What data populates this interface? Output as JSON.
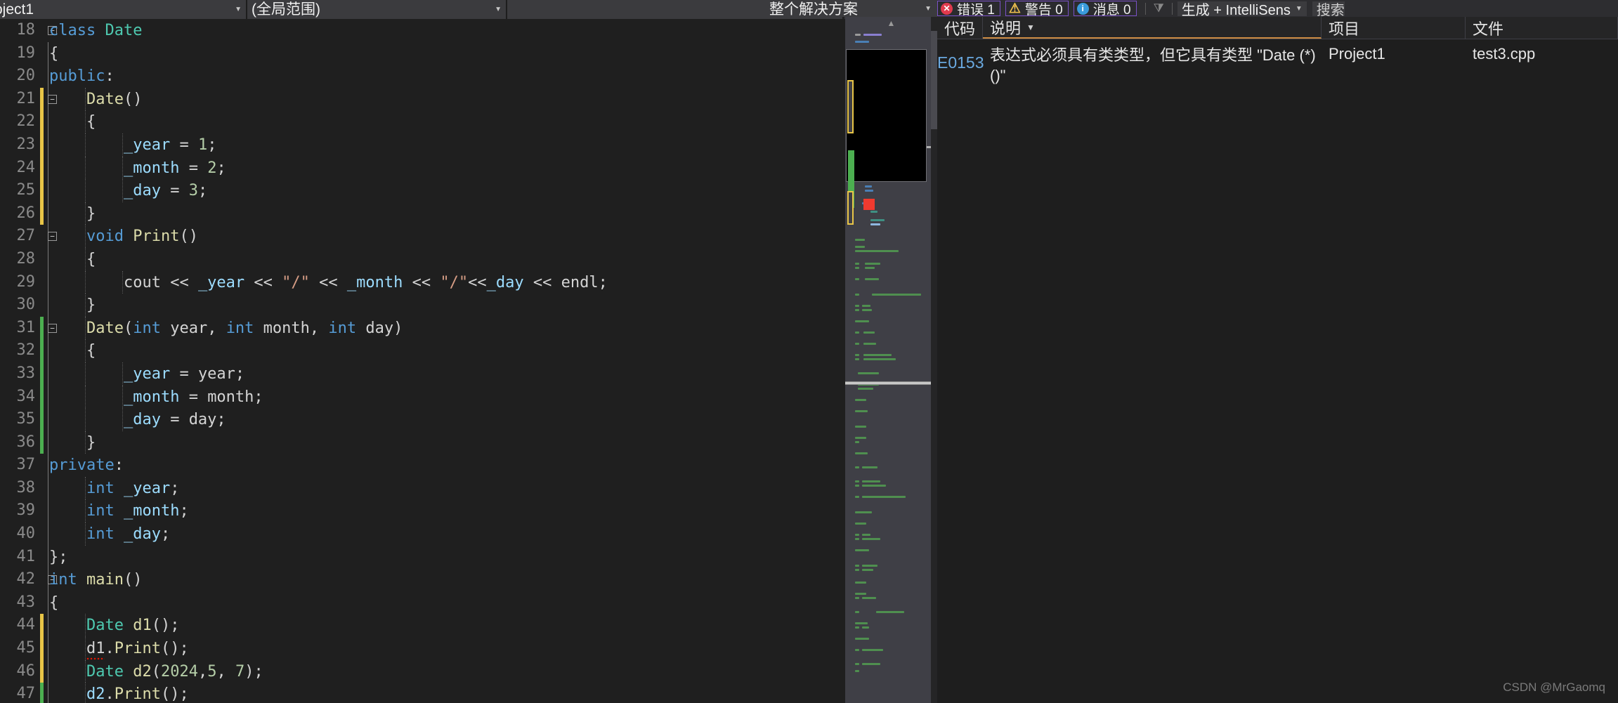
{
  "editor_navbar": {
    "project_combo": "oject1",
    "scope_combo": "(全局范围)",
    "member_combo": ""
  },
  "code": {
    "language": "cpp",
    "lines": [
      {
        "n": 18,
        "text": "class Date",
        "fold": "minus",
        "marker": "none",
        "tokens": [
          {
            "t": "class",
            "c": "kw"
          },
          {
            "t": " ",
            "c": "pl"
          },
          {
            "t": "Date",
            "c": "typ"
          }
        ],
        "indent": 0
      },
      {
        "n": 19,
        "text": "{",
        "fold": "none",
        "marker": "none",
        "tokens": [
          {
            "t": "{",
            "c": "pl"
          }
        ],
        "indent": 0
      },
      {
        "n": 20,
        "text": "public:",
        "fold": "none",
        "marker": "none",
        "tokens": [
          {
            "t": "public",
            "c": "kw"
          },
          {
            "t": ":",
            "c": "pl"
          }
        ],
        "indent": 0
      },
      {
        "n": 21,
        "text": "    Date()",
        "fold": "minus",
        "marker": "yellow",
        "tokens": [
          {
            "t": "    ",
            "c": "pl"
          },
          {
            "t": "Date",
            "c": "fn"
          },
          {
            "t": "()",
            "c": "pl"
          }
        ],
        "indent": 1
      },
      {
        "n": 22,
        "text": "    {",
        "fold": "none",
        "marker": "yellow",
        "tokens": [
          {
            "t": "    {",
            "c": "pl"
          }
        ],
        "indent": 1
      },
      {
        "n": 23,
        "text": "        _year = 1;",
        "fold": "none",
        "marker": "yellow",
        "tokens": [
          {
            "t": "        ",
            "c": "pl"
          },
          {
            "t": "_year",
            "c": "var"
          },
          {
            "t": " = ",
            "c": "pl"
          },
          {
            "t": "1",
            "c": "num"
          },
          {
            "t": ";",
            "c": "pl"
          }
        ],
        "indent": 2
      },
      {
        "n": 24,
        "text": "        _month = 2;",
        "fold": "none",
        "marker": "yellow",
        "tokens": [
          {
            "t": "        ",
            "c": "pl"
          },
          {
            "t": "_month",
            "c": "var"
          },
          {
            "t": " = ",
            "c": "pl"
          },
          {
            "t": "2",
            "c": "num"
          },
          {
            "t": ";",
            "c": "pl"
          }
        ],
        "indent": 2
      },
      {
        "n": 25,
        "text": "        _day = 3;",
        "fold": "none",
        "marker": "yellow",
        "tokens": [
          {
            "t": "        ",
            "c": "pl"
          },
          {
            "t": "_day",
            "c": "var"
          },
          {
            "t": " = ",
            "c": "pl"
          },
          {
            "t": "3",
            "c": "num"
          },
          {
            "t": ";",
            "c": "pl"
          }
        ],
        "indent": 2
      },
      {
        "n": 26,
        "text": "    }",
        "fold": "none",
        "marker": "yellow",
        "tokens": [
          {
            "t": "    }",
            "c": "pl"
          }
        ],
        "indent": 1
      },
      {
        "n": 27,
        "text": "    void Print()",
        "fold": "minus",
        "marker": "none",
        "tokens": [
          {
            "t": "    ",
            "c": "pl"
          },
          {
            "t": "void",
            "c": "kw"
          },
          {
            "t": " ",
            "c": "pl"
          },
          {
            "t": "Print",
            "c": "fn"
          },
          {
            "t": "()",
            "c": "pl"
          }
        ],
        "indent": 1
      },
      {
        "n": 28,
        "text": "    {",
        "fold": "none",
        "marker": "none",
        "tokens": [
          {
            "t": "    {",
            "c": "pl"
          }
        ],
        "indent": 1
      },
      {
        "n": 29,
        "text": "        cout << _year << \"/\" << _month << \"/\"<<_day << endl;",
        "fold": "none",
        "marker": "none",
        "tokens": [
          {
            "t": "        ",
            "c": "pl"
          },
          {
            "t": "cout",
            "c": "pl"
          },
          {
            "t": " << ",
            "c": "pl"
          },
          {
            "t": "_year",
            "c": "var"
          },
          {
            "t": " << ",
            "c": "pl"
          },
          {
            "t": "\"/\"",
            "c": "str"
          },
          {
            "t": " << ",
            "c": "pl"
          },
          {
            "t": "_month",
            "c": "var"
          },
          {
            "t": " << ",
            "c": "pl"
          },
          {
            "t": "\"/\"",
            "c": "str"
          },
          {
            "t": "<<",
            "c": "pl"
          },
          {
            "t": "_day",
            "c": "var"
          },
          {
            "t": " << ",
            "c": "pl"
          },
          {
            "t": "endl",
            "c": "pl"
          },
          {
            "t": ";",
            "c": "pl"
          }
        ],
        "indent": 2
      },
      {
        "n": 30,
        "text": "    }",
        "fold": "none",
        "marker": "none",
        "tokens": [
          {
            "t": "    }",
            "c": "pl"
          }
        ],
        "indent": 1
      },
      {
        "n": 31,
        "text": "    Date(int year, int month, int day)",
        "fold": "minus",
        "marker": "green",
        "tokens": [
          {
            "t": "    ",
            "c": "pl"
          },
          {
            "t": "Date",
            "c": "fn"
          },
          {
            "t": "(",
            "c": "pl"
          },
          {
            "t": "int",
            "c": "kw"
          },
          {
            "t": " year, ",
            "c": "pl"
          },
          {
            "t": "int",
            "c": "kw"
          },
          {
            "t": " month, ",
            "c": "pl"
          },
          {
            "t": "int",
            "c": "kw"
          },
          {
            "t": " day)",
            "c": "pl"
          }
        ],
        "indent": 1
      },
      {
        "n": 32,
        "text": "    {",
        "fold": "none",
        "marker": "green",
        "tokens": [
          {
            "t": "    {",
            "c": "pl"
          }
        ],
        "indent": 1
      },
      {
        "n": 33,
        "text": "        _year = year;",
        "fold": "none",
        "marker": "green",
        "tokens": [
          {
            "t": "        ",
            "c": "pl"
          },
          {
            "t": "_year",
            "c": "var"
          },
          {
            "t": " = year;",
            "c": "pl"
          }
        ],
        "indent": 2
      },
      {
        "n": 34,
        "text": "        _month = month;",
        "fold": "none",
        "marker": "green",
        "tokens": [
          {
            "t": "        ",
            "c": "pl"
          },
          {
            "t": "_month",
            "c": "var"
          },
          {
            "t": " = month;",
            "c": "pl"
          }
        ],
        "indent": 2
      },
      {
        "n": 35,
        "text": "        _day = day;",
        "fold": "none",
        "marker": "green",
        "tokens": [
          {
            "t": "        ",
            "c": "pl"
          },
          {
            "t": "_day",
            "c": "var"
          },
          {
            "t": " = day;",
            "c": "pl"
          }
        ],
        "indent": 2
      },
      {
        "n": 36,
        "text": "    }",
        "fold": "none",
        "marker": "green",
        "tokens": [
          {
            "t": "    }",
            "c": "pl"
          }
        ],
        "indent": 1
      },
      {
        "n": 37,
        "text": "private:",
        "fold": "none",
        "marker": "none",
        "tokens": [
          {
            "t": "private",
            "c": "kw"
          },
          {
            "t": ":",
            "c": "pl"
          }
        ],
        "indent": 0
      },
      {
        "n": 38,
        "text": "    int _year;",
        "fold": "none",
        "marker": "none",
        "tokens": [
          {
            "t": "    ",
            "c": "pl"
          },
          {
            "t": "int",
            "c": "kw"
          },
          {
            "t": " ",
            "c": "pl"
          },
          {
            "t": "_year",
            "c": "var"
          },
          {
            "t": ";",
            "c": "pl"
          }
        ],
        "indent": 1
      },
      {
        "n": 39,
        "text": "    int _month;",
        "fold": "none",
        "marker": "none",
        "tokens": [
          {
            "t": "    ",
            "c": "pl"
          },
          {
            "t": "int",
            "c": "kw"
          },
          {
            "t": " ",
            "c": "pl"
          },
          {
            "t": "_month",
            "c": "var"
          },
          {
            "t": ";",
            "c": "pl"
          }
        ],
        "indent": 1
      },
      {
        "n": 40,
        "text": "    int _day;",
        "fold": "none",
        "marker": "none",
        "tokens": [
          {
            "t": "    ",
            "c": "pl"
          },
          {
            "t": "int",
            "c": "kw"
          },
          {
            "t": " ",
            "c": "pl"
          },
          {
            "t": "_day",
            "c": "var"
          },
          {
            "t": ";",
            "c": "pl"
          }
        ],
        "indent": 1
      },
      {
        "n": 41,
        "text": "};",
        "fold": "none",
        "marker": "none",
        "tokens": [
          {
            "t": "};",
            "c": "pl"
          }
        ],
        "indent": 0
      },
      {
        "n": 42,
        "text": "int main()",
        "fold": "minus",
        "marker": "none",
        "tokens": [
          {
            "t": "int",
            "c": "kw"
          },
          {
            "t": " ",
            "c": "pl"
          },
          {
            "t": "main",
            "c": "fn"
          },
          {
            "t": "()",
            "c": "pl"
          }
        ],
        "indent": 0
      },
      {
        "n": 43,
        "text": "{",
        "fold": "none",
        "marker": "none",
        "tokens": [
          {
            "t": "{",
            "c": "pl"
          }
        ],
        "indent": 0
      },
      {
        "n": 44,
        "text": "    Date d1();",
        "fold": "none",
        "marker": "yellow",
        "tokens": [
          {
            "t": "    ",
            "c": "pl"
          },
          {
            "t": "Date",
            "c": "typ"
          },
          {
            "t": " ",
            "c": "pl"
          },
          {
            "t": "d1",
            "c": "fn"
          },
          {
            "t": "();",
            "c": "pl"
          }
        ],
        "indent": 1
      },
      {
        "n": 45,
        "text": "    d1.Print();",
        "fold": "none",
        "marker": "yellow",
        "error": true,
        "tokens": [
          {
            "t": "    ",
            "c": "pl"
          },
          {
            "t": "d1",
            "c": "pl err"
          },
          {
            "t": ".",
            "c": "pl"
          },
          {
            "t": "Print",
            "c": "fn"
          },
          {
            "t": "();",
            "c": "pl"
          }
        ],
        "indent": 1
      },
      {
        "n": 46,
        "text": "    Date d2(2024,5, 7);",
        "fold": "none",
        "marker": "yellow",
        "tokens": [
          {
            "t": "    ",
            "c": "pl"
          },
          {
            "t": "Date",
            "c": "typ"
          },
          {
            "t": " ",
            "c": "pl"
          },
          {
            "t": "d2",
            "c": "fn"
          },
          {
            "t": "(",
            "c": "pl"
          },
          {
            "t": "2024",
            "c": "num"
          },
          {
            "t": ",",
            "c": "pl"
          },
          {
            "t": "5",
            "c": "num"
          },
          {
            "t": ", ",
            "c": "pl"
          },
          {
            "t": "7",
            "c": "num"
          },
          {
            "t": ");",
            "c": "pl"
          }
        ],
        "indent": 1
      },
      {
        "n": 47,
        "text": "    d2.Print();",
        "fold": "none",
        "marker": "green",
        "tokens": [
          {
            "t": "    ",
            "c": "pl"
          },
          {
            "t": "d2",
            "c": "var"
          },
          {
            "t": ".",
            "c": "pl"
          },
          {
            "t": "Print",
            "c": "fn"
          },
          {
            "t": "();",
            "c": "pl"
          }
        ],
        "indent": 1
      }
    ]
  },
  "minimap": {
    "scroll_down_icon": "▼",
    "scroll_up_icon": "▲"
  },
  "error_list": {
    "scope_combo": "整个解决方案",
    "severity_buttons": [
      {
        "id": "errors",
        "icon": "error-icon",
        "glyph": "✕",
        "label": "错误 1"
      },
      {
        "id": "warnings",
        "icon": "warning-icon",
        "glyph": "⚠",
        "label": "警告 0"
      },
      {
        "id": "messages",
        "icon": "info-icon",
        "glyph": "i",
        "label": "消息 0"
      }
    ],
    "filter_icon": "filter-icon",
    "build_combo": "生成 + IntelliSens",
    "search_placeholder": "搜索",
    "columns": [
      {
        "id": "code",
        "label": "代码",
        "sorted": false
      },
      {
        "id": "desc",
        "label": "说明",
        "sorted": true
      },
      {
        "id": "project",
        "label": "项目",
        "sorted": false
      },
      {
        "id": "file",
        "label": "文件",
        "sorted": false
      }
    ],
    "rows": [
      {
        "code": "E0153",
        "description": "表达式必须具有类类型，但它具有类型 \"Date (*)()\"",
        "project": "Project1",
        "file": "test3.cpp"
      }
    ]
  },
  "watermark": "CSDN @MrGaomq",
  "colors": {
    "accent_purple": "#7a52c7",
    "error_red": "#e03a4e",
    "warning_yellow": "#f2c14e",
    "info_blue": "#3a9bdc",
    "change_yellow": "#e8c547",
    "change_green": "#4caf50"
  }
}
